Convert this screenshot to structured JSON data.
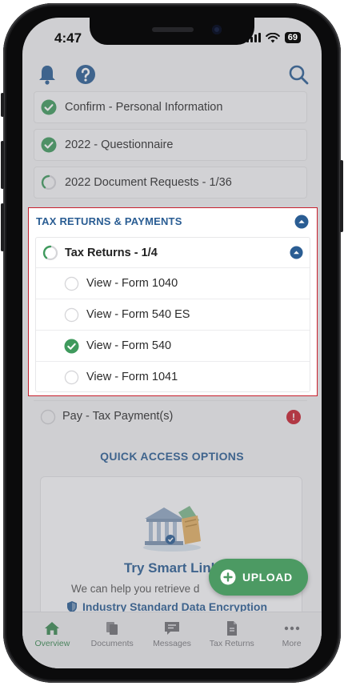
{
  "status_bar": {
    "time": "4:47",
    "battery": "69"
  },
  "completed_items": [
    {
      "label": "Confirm - Personal Information",
      "status": "complete"
    },
    {
      "label": "2022 - Questionnaire",
      "status": "complete"
    },
    {
      "label": "2022 Document Requests - 1/36",
      "status": "in-progress"
    }
  ],
  "tax_section": {
    "title": "TAX RETURNS & PAYMENTS",
    "tax_returns": {
      "label": "Tax Returns - 1/4",
      "items": [
        {
          "label": "View - Form 1040",
          "status": "pending"
        },
        {
          "label": "View - Form 540 ES",
          "status": "pending"
        },
        {
          "label": "View - Form 540",
          "status": "complete"
        },
        {
          "label": "View - Form 1041",
          "status": "pending"
        }
      ]
    },
    "payment": {
      "label": "Pay - Tax Payment(s)",
      "alert": "!"
    }
  },
  "quick_access": {
    "title": "QUICK ACCESS OPTIONS",
    "card_title": "Try Smart Link",
    "card_subtitle": "We can help you retrieve d",
    "encryption_text": "Industry Standard Data Encryption"
  },
  "upload_label": "UPLOAD",
  "tabs": [
    {
      "label": "Overview",
      "icon": "home-icon",
      "active": true
    },
    {
      "label": "Documents",
      "icon": "documents-icon",
      "active": false
    },
    {
      "label": "Messages",
      "icon": "messages-icon",
      "active": false
    },
    {
      "label": "Tax Returns",
      "icon": "tax-returns-icon",
      "active": false
    },
    {
      "label": "More",
      "icon": "more-icon",
      "active": false
    }
  ],
  "colors": {
    "brand_blue": "#2a5d93",
    "success_green": "#3f9a5d",
    "alert_red": "#c8202e",
    "highlight_border": "#c8202e"
  }
}
